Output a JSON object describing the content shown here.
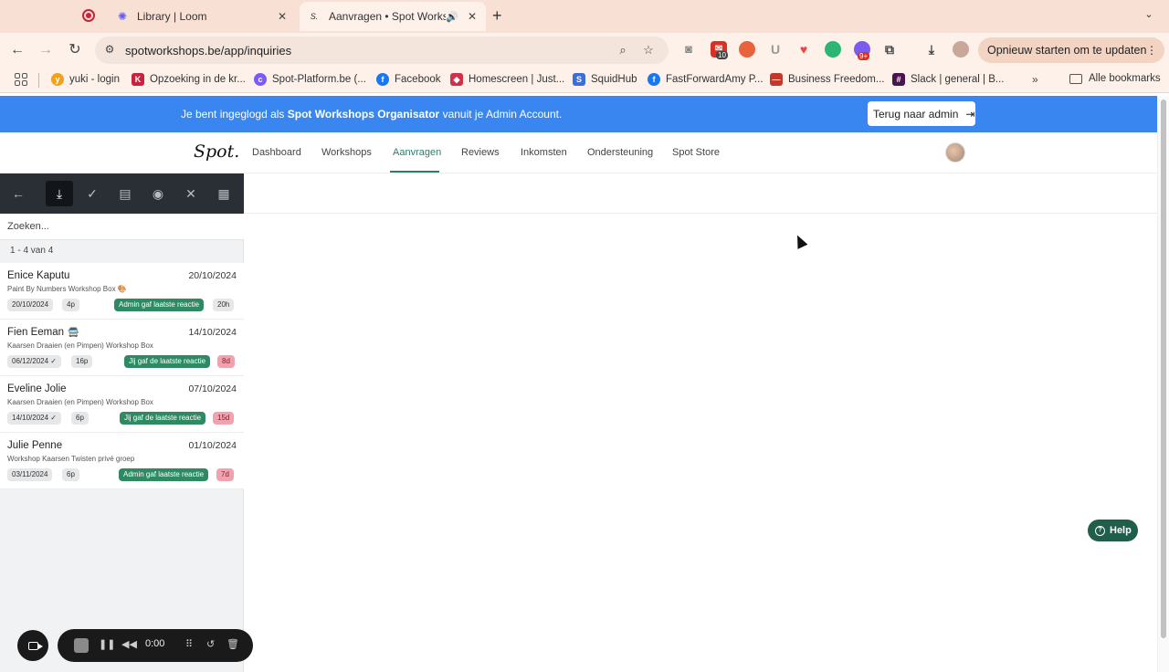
{
  "browser": {
    "tabs": [
      {
        "title": "Library | Loom",
        "icon": "loom-icon"
      },
      {
        "title": "Aanvragen • Spot Worksh",
        "icon": "spot-icon"
      }
    ],
    "url": "spotworkshops.be/app/inquiries",
    "update_button": "Opnieuw starten om te updaten",
    "extension_badges": {
      "mail": "10",
      "notif": "9+"
    },
    "bookmarks": [
      {
        "label": "yuki - login",
        "icon": "yuki-icon",
        "color": "#f0a21c"
      },
      {
        "label": "Opzoeking in de kr...",
        "icon": "kbo-icon",
        "color": "#c8223c"
      },
      {
        "label": "Spot-Platform.be (...",
        "icon": "spot-platform-icon",
        "color": "#7a5af8"
      },
      {
        "label": "Facebook",
        "icon": "facebook-icon",
        "color": "#1877f2"
      },
      {
        "label": "Homescreen | Just...",
        "icon": "homescreen-icon",
        "color": "#d0304a"
      },
      {
        "label": "SquidHub",
        "icon": "squidhub-icon",
        "color": "#3a6fd8"
      },
      {
        "label": "FastForwardAmy P...",
        "icon": "facebook-icon",
        "color": "#1877f2"
      },
      {
        "label": "Business Freedom...",
        "icon": "business-icon",
        "color": "#c0392b"
      },
      {
        "label": "Slack | general | B...",
        "icon": "slack-icon",
        "color": "#4a154b"
      }
    ],
    "all_bookmarks": "Alle bookmarks"
  },
  "banner": {
    "prefix": "Je bent ingeglogd als",
    "org": "Spot Workshops Organisator",
    "suffix": "vanuit je Admin Account.",
    "back_button": "Terug naar admin"
  },
  "nav": {
    "logo": "Spot.",
    "links": [
      "Dashboard",
      "Workshops",
      "Aanvragen",
      "Reviews",
      "Inkomsten",
      "Ondersteuning",
      "Spot Store"
    ],
    "active": "Aanvragen"
  },
  "sidebar": {
    "search_placeholder": "Zoeken...",
    "count": "1 - 4 van 4",
    "inquiries": [
      {
        "name": "Enice Kaputu",
        "emoji": "🎨",
        "date": "20/10/2024",
        "workshop": "Paint By Numbers Workshop Box 🎨",
        "event_date": "20/10/2024",
        "event_check": false,
        "people": "4p",
        "status": "Admin gaf laatste reactie",
        "age": "20h",
        "age_style": "grey"
      },
      {
        "name": "Fien Eeman",
        "emoji": "🚍",
        "date": "14/10/2024",
        "workshop": "Kaarsen Draaien (en Pimpen) Workshop Box",
        "event_date": "06/12/2024",
        "event_check": true,
        "people": "16p",
        "status": "Jij gaf de laatste reactie",
        "age": "8d",
        "age_style": "pink"
      },
      {
        "name": "Eveline Jolie",
        "emoji": "",
        "date": "07/10/2024",
        "workshop": "Kaarsen Draaien (en Pimpen) Workshop Box",
        "event_date": "14/10/2024",
        "event_check": true,
        "people": "6p",
        "status": "Jij gaf de laatste reactie",
        "age": "15d",
        "age_style": "pink"
      },
      {
        "name": "Julie Penne",
        "emoji": "",
        "date": "01/10/2024",
        "workshop": "Workshop Kaarsen Twisten privé groep",
        "event_date": "03/11/2024",
        "event_check": false,
        "people": "6p",
        "status": "Admin gaf laatste reactie",
        "age": "7d",
        "age_style": "pink"
      }
    ]
  },
  "help": {
    "label": "Help"
  },
  "loom": {
    "timer": "0:00"
  },
  "colors": {
    "banner": "#3a86f0",
    "accent": "#2e7d6b",
    "status_green": "#2f8a63",
    "age_pink": "#f0a3ae",
    "help": "#1f5e4a"
  }
}
